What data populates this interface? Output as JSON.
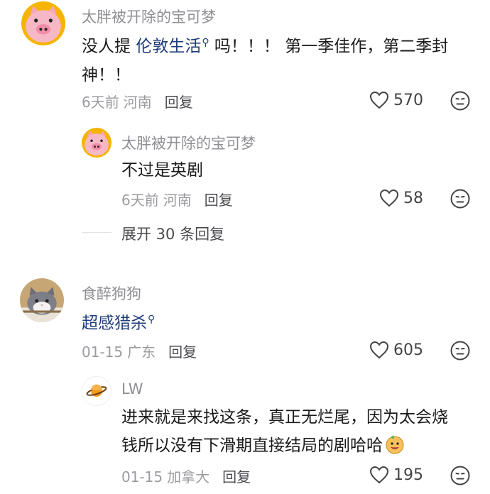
{
  "comments": [
    {
      "username": "太胖被开除的宝可梦",
      "text_before": "没人提 ",
      "link": "伦敦生活",
      "text_after": " 吗！！！ 第一季佳作，第二季封",
      "text_line2": "神！！",
      "time": "6天前",
      "location": "河南",
      "reply_label": "回复",
      "likes": "570",
      "avatar_icon": "pig-avatar-icon",
      "reply": {
        "username": "太胖被开除的宝可梦",
        "text": "不过是英剧",
        "time": "6天前",
        "location": "河南",
        "reply_label": "回复",
        "likes": "58",
        "avatar_icon": "pig-avatar-icon"
      },
      "expand_label": "展开 30 条回复"
    },
    {
      "username": "食醉狗狗",
      "link": "超感猎杀",
      "time": "01-15",
      "location": "广东",
      "reply_label": "回复",
      "likes": "605",
      "avatar_icon": "cat-avatar-icon",
      "reply": {
        "username": "LW",
        "text_line1": "进来就是来找这条，真正无烂尾，因为太会烧",
        "text_line2": "钱所以没有下滑期直接结局的剧哈哈",
        "time": "01-15",
        "location": "加拿大",
        "reply_label": "回复",
        "likes": "195",
        "avatar_icon": "planet-avatar-icon"
      }
    }
  ],
  "colors": {
    "username": "#8f8f95",
    "link": "#1f3d7a",
    "meta": "#9b9ba1"
  }
}
